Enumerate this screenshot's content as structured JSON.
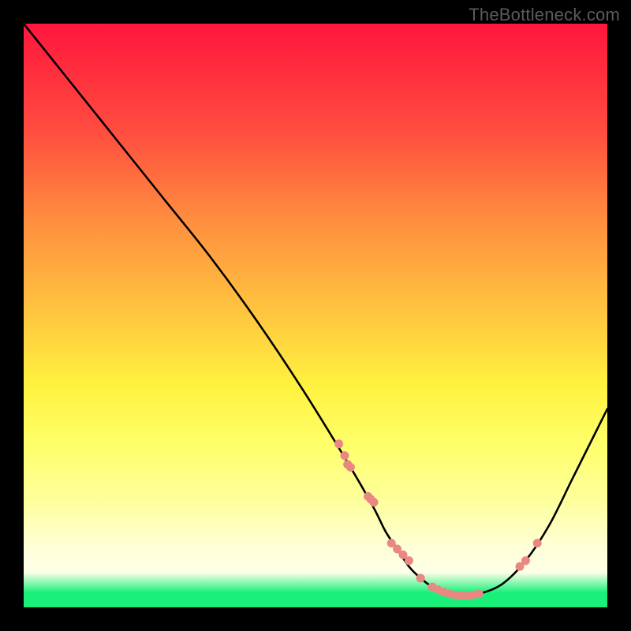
{
  "watermark": "TheBottleneck.com",
  "chart_data": {
    "type": "line",
    "title": "",
    "xlabel": "",
    "ylabel": "",
    "xlim": [
      0,
      100
    ],
    "ylim": [
      0,
      100
    ],
    "series": [
      {
        "name": "curve",
        "x": [
          0,
          8,
          16,
          24,
          32,
          40,
          48,
          56,
          60,
          62,
          64,
          66,
          68,
          70,
          72,
          74,
          76,
          78,
          82,
          86,
          90,
          94,
          98,
          100
        ],
        "values": [
          100,
          90,
          80,
          70,
          60,
          49,
          37,
          24,
          17,
          13,
          10,
          7,
          5,
          3.5,
          2.5,
          2,
          2,
          2.3,
          4,
          8,
          14,
          22,
          30,
          34
        ]
      }
    ],
    "markers": {
      "name": "scatter",
      "x": [
        54,
        55,
        55.5,
        56,
        59,
        59.5,
        60,
        63,
        64,
        65,
        66,
        68,
        70,
        71,
        72,
        73,
        74,
        75,
        76,
        77,
        78,
        85,
        86,
        88
      ],
      "values": [
        28,
        26,
        24.5,
        24,
        19,
        18.5,
        18,
        11,
        10,
        9,
        8,
        5,
        3.5,
        3,
        2.6,
        2.3,
        2.1,
        2.0,
        2.0,
        2.1,
        2.3,
        7,
        8,
        11
      ],
      "color": "#e98882",
      "size": 5.5
    },
    "background": {
      "type": "vertical-gradient",
      "stops": [
        {
          "pct": 0,
          "color": "#ff163d"
        },
        {
          "pct": 18,
          "color": "#ff4b3f"
        },
        {
          "pct": 34,
          "color": "#ff8f3f"
        },
        {
          "pct": 50,
          "color": "#ffc73f"
        },
        {
          "pct": 62,
          "color": "#fff23f"
        },
        {
          "pct": 72,
          "color": "#ffff6a"
        },
        {
          "pct": 82,
          "color": "#feff9e"
        },
        {
          "pct": 90,
          "color": "#feffd8"
        },
        {
          "pct": 94,
          "color": "#feffe7"
        },
        {
          "pct": 97.5,
          "color": "#18f07a"
        },
        {
          "pct": 100,
          "color": "#18f07a"
        }
      ]
    }
  }
}
